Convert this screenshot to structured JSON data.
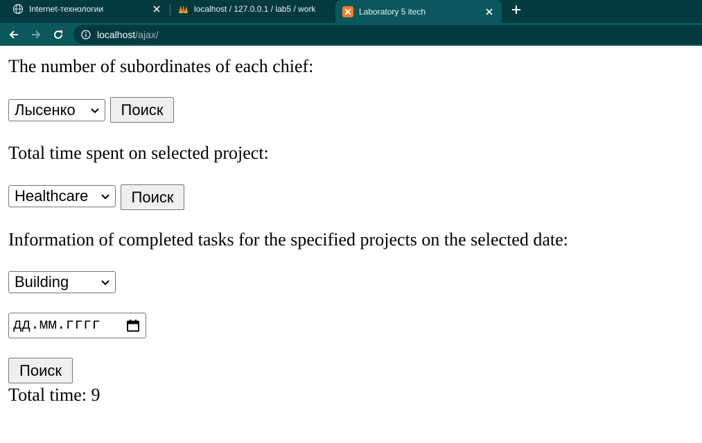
{
  "browser": {
    "tabs": [
      {
        "title": "Internet-технологии",
        "icon": "globe-icon"
      },
      {
        "title": "localhost / 127.0.0.1 / lab5 / work",
        "icon": "phpmyadmin-icon"
      },
      {
        "title": "Laboratory 5 itech",
        "icon": "xampp-icon",
        "active": true
      }
    ],
    "new_tab_label": "+",
    "url_host": "localhost",
    "url_path": "/ajax/"
  },
  "page": {
    "section1_heading": "The number of subordinates of each chief:",
    "chief_select_value": "Лысенко",
    "search1_label": "Поиск",
    "section2_heading": "Total time spent on selected project:",
    "project_select_value": "Healthcare",
    "search2_label": "Поиск",
    "section3_heading": "Information of completed tasks for the specified projects on the selected date:",
    "project_select2_value": "Building",
    "date_placeholder": "дд.мм.гггг",
    "search3_label": "Поиск",
    "result_text": "Total time: 9"
  },
  "colors": {
    "tabstrip": "#023a3f",
    "toolbar": "#0a575d",
    "button_bg": "#efefef"
  }
}
